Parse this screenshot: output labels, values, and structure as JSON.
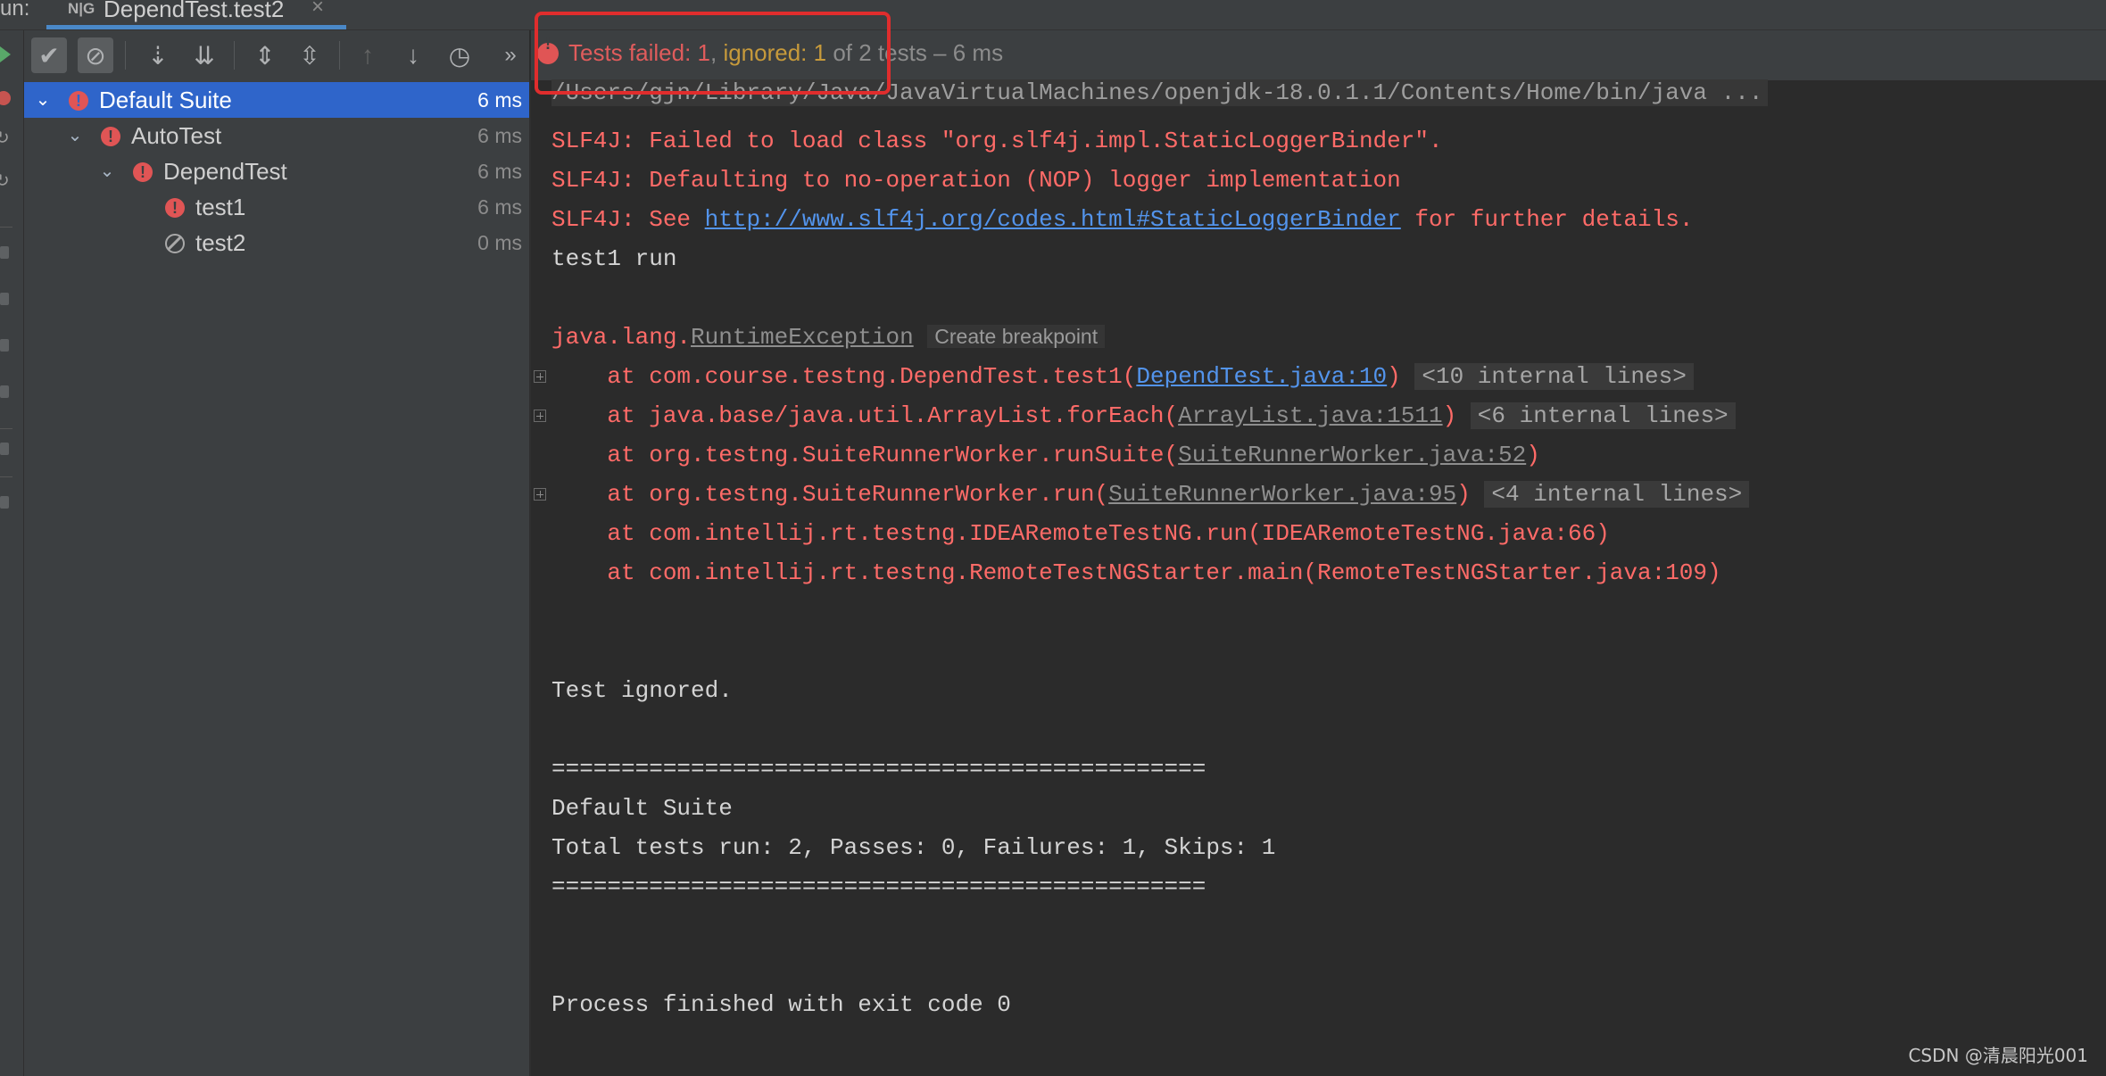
{
  "run_tab": {
    "prefix": "un:",
    "icon": "N|G",
    "title": "DependTest.test2",
    "close": "×"
  },
  "toolbar": {
    "buttons": [
      "show-passed-icon",
      "show-ignored-icon",
      "sort-alpha-icon",
      "sort-duration-icon",
      "expand-all-icon",
      "collapse-all-icon",
      "prev-failed-icon",
      "next-failed-icon",
      "history-icon",
      "more-icon"
    ],
    "more": "»"
  },
  "tree": {
    "rows": [
      {
        "name": "Default Suite",
        "duration": "6 ms",
        "status": "failed"
      },
      {
        "name": "AutoTest",
        "duration": "6 ms",
        "status": "failed"
      },
      {
        "name": "DependTest",
        "duration": "6 ms",
        "status": "failed"
      },
      {
        "name": "test1",
        "duration": "6 ms",
        "status": "failed"
      },
      {
        "name": "test2",
        "duration": "0 ms",
        "status": "ignored"
      }
    ]
  },
  "status": {
    "failed": "Tests failed: 1",
    "sep": ", ",
    "ignored": "ignored: 1",
    "rest": " of 2 tests – 6 ms"
  },
  "console": {
    "cmd": "/Users/gjn/Library/Java/JavaVirtualMachines/openjdk-18.0.1.1/Contents/Home/bin/java ...",
    "slf1": "SLF4J: Failed to load class \"org.slf4j.impl.StaticLoggerBinder\".",
    "slf2": "SLF4J: Defaulting to no-operation (NOP) logger implementation",
    "slf3_pre": "SLF4J: See ",
    "slf3_link": "http://www.slf4j.org/codes.html#StaticLoggerBinder",
    "slf3_post": " for further details.",
    "test1_run": "test1 run",
    "exc_pre": "java.lang.",
    "exc_name": "RuntimeException",
    "create_bp": "Create breakpoint",
    "st1_pre": "    at com.course.testng.DependTest.test1(",
    "st1_link": "DependTest.java:10",
    "st1_post": ")",
    "st1_int": "<10 internal lines>",
    "st2_pre": "    at java.base/java.util.ArrayList.forEach(",
    "st2_link": "ArrayList.java:1511",
    "st2_post": ")",
    "st2_int": "<6 internal lines>",
    "st3_pre": "    at org.testng.SuiteRunnerWorker.runSuite(",
    "st3_link": "SuiteRunnerWorker.java:52",
    "st3_post": ")",
    "st4_pre": "    at org.testng.SuiteRunnerWorker.run(",
    "st4_link": "SuiteRunnerWorker.java:95",
    "st4_post": ")",
    "st4_int": "<4 internal lines>",
    "st5": "    at com.intellij.rt.testng.IDEARemoteTestNG.run(IDEARemoteTestNG.java:66)",
    "st6": "    at com.intellij.rt.testng.RemoteTestNGStarter.main(RemoteTestNGStarter.java:109)",
    "ignored": "Test ignored.",
    "sep1": "===============================================",
    "suite": "Default Suite",
    "totals": "Total tests run: 2, Passes: 0, Failures: 1, Skips: 1",
    "sep2": "===============================================",
    "finish": "Process finished with exit code 0"
  },
  "watermark": "CSDN @清晨阳光001",
  "colors": {
    "error": "#ff6b68",
    "link": "#5394ec",
    "selection": "#2f65ca",
    "ignored": "#c79a3b",
    "highlight": "#e02d2d"
  }
}
